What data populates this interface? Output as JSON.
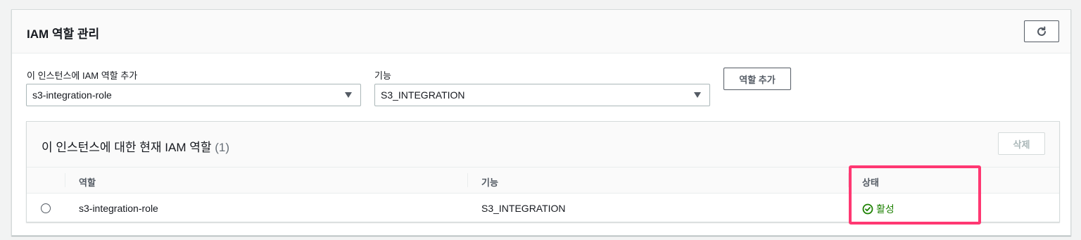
{
  "panel": {
    "title": "IAM 역할 관리"
  },
  "form": {
    "role_label": "이 인스턴스에 IAM 역할 추가",
    "role_value": "s3-integration-role",
    "feature_label": "기능",
    "feature_value": "S3_INTEGRATION",
    "add_button": "역할 추가"
  },
  "current_roles": {
    "title": "이 인스턴스에 대한 현재 IAM 역할",
    "count": "(1)",
    "delete_button": "삭제",
    "columns": [
      "역할",
      "기능",
      "상태"
    ],
    "rows": [
      {
        "role": "s3-integration-role",
        "feature": "S3_INTEGRATION",
        "status": "활성"
      }
    ]
  },
  "colors": {
    "status_active": "#1d8102",
    "highlight": "#ff3872"
  }
}
